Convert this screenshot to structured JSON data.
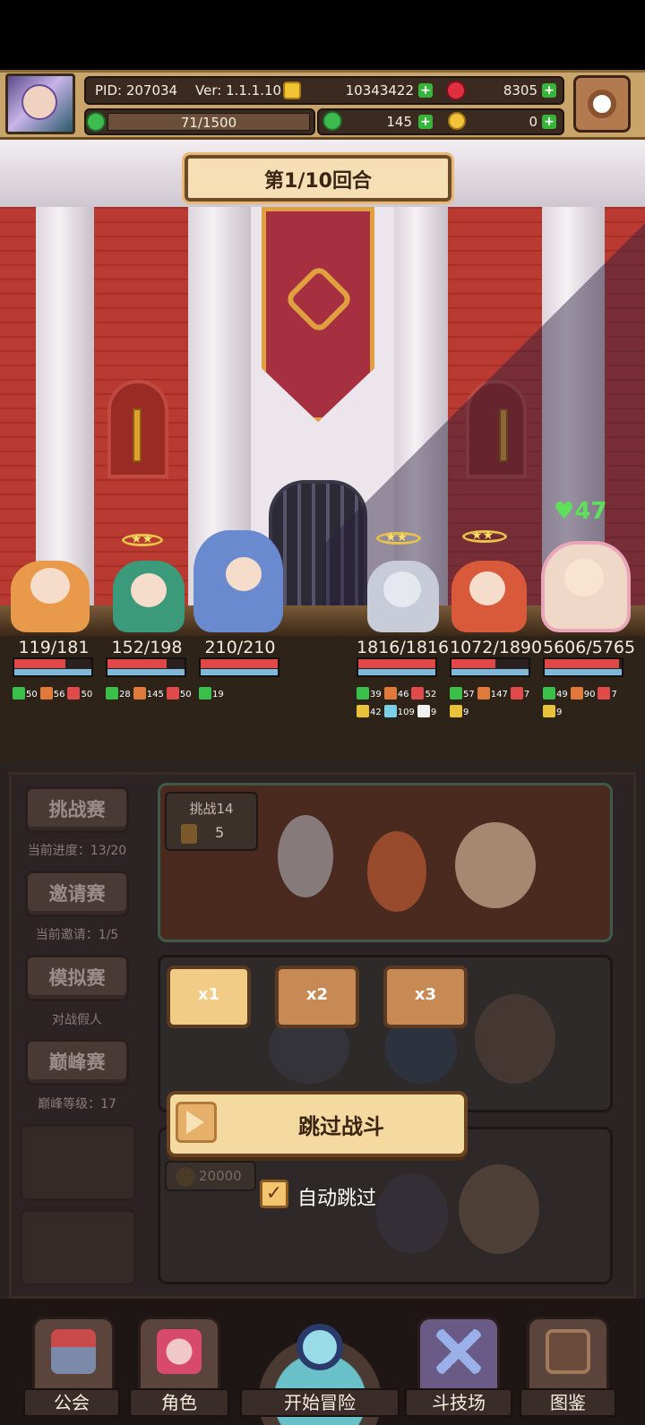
{
  "header": {
    "pid": "PID: 207034",
    "version": "Ver: 1.1.1.10",
    "gold": "10343422",
    "gems": "8305",
    "stamina": "71/1500",
    "clover": "145",
    "eggs": "0",
    "icons": {
      "gold": "gold-coin-icon",
      "gems": "red-gem-icon",
      "stamina": "green-clover-icon",
      "clover": "clover-icon",
      "eggs": "golden-egg-icon",
      "settings": "gear-icon"
    }
  },
  "battle": {
    "round_label": "第1/10回合",
    "enemy_buff_popup": "47",
    "allies": [
      {
        "hp": "119/181",
        "hp_ratio": 0.66,
        "buffs": [
          "50",
          "56",
          "50"
        ]
      },
      {
        "hp": "152/198",
        "hp_ratio": 0.77,
        "buffs": [
          "28",
          "145",
          "50"
        ]
      },
      {
        "hp": "210/210",
        "hp_ratio": 1.0,
        "buffs": [
          "19"
        ]
      }
    ],
    "enemies": [
      {
        "hp": "1816/1816",
        "hp_ratio": 1.0,
        "buffs": [
          "39",
          "46",
          "52",
          "42",
          "109",
          "9"
        ]
      },
      {
        "hp": "1072/1890",
        "hp_ratio": 0.57,
        "buffs": [
          "57",
          "147",
          "7",
          "9"
        ]
      },
      {
        "hp": "5606/5765",
        "hp_ratio": 0.97,
        "buffs": [
          "49",
          "90",
          "7",
          "9"
        ]
      }
    ]
  },
  "menu": {
    "side": [
      {
        "label": "挑战赛",
        "sub": "当前进度：13/20"
      },
      {
        "label": "邀请赛",
        "sub": "当前邀请：1/5"
      },
      {
        "label": "模拟赛",
        "sub": "对战假人"
      },
      {
        "label": "巅峰赛",
        "sub": "巅峰等级：17"
      }
    ],
    "challenge_tag": "挑战14",
    "challenge_cost": "5",
    "speed": [
      "x1",
      "x2",
      "x3"
    ],
    "skip_label": "跳过战斗",
    "pill_cost": "20000",
    "auto_skip_label": "自动跳过",
    "auto_skip_checked": true
  },
  "nav": {
    "items": [
      "公会",
      "角色",
      "开始冒险",
      "斗技场",
      "图鉴"
    ]
  },
  "colors": {
    "accent_gold": "#f2cc86",
    "hp_red": "#e04848",
    "shield_blue": "#7fb8d8",
    "plus_green": "#38b43a"
  }
}
